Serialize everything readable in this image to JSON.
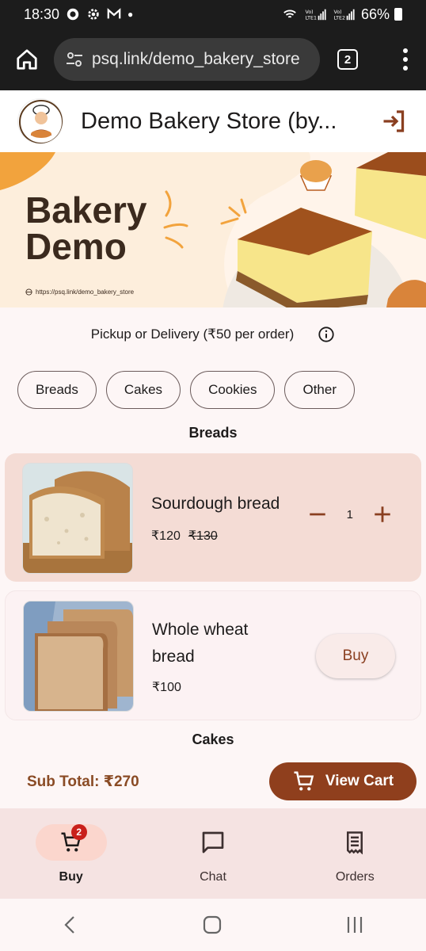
{
  "status_bar": {
    "time": "18:30",
    "battery": "66%"
  },
  "browser": {
    "url": "psq.link/demo_bakery_store",
    "tab_count": "2"
  },
  "header": {
    "title": "Demo Bakery Store (by..."
  },
  "banner": {
    "title_line1": "Bakery",
    "title_line2": "Demo",
    "url": "https://psq.link/demo_bakery_store"
  },
  "info": {
    "text": "Pickup or Delivery (₹50 per order)"
  },
  "categories": [
    "Breads",
    "Cakes",
    "Cookies",
    "Other"
  ],
  "sections": {
    "breads": "Breads",
    "cakes": "Cakes"
  },
  "products": [
    {
      "name": "Sourdough bread",
      "price": "₹120",
      "old_price": "₹130",
      "qty": "1"
    },
    {
      "name_line1": "Whole wheat",
      "name_line2": "bread",
      "price": "₹100",
      "action": "Buy"
    }
  ],
  "cart": {
    "subtotal": "Sub Total: ₹270",
    "view_cart": "View Cart"
  },
  "nav": {
    "buy": "Buy",
    "chat": "Chat",
    "orders": "Orders",
    "badge": "2"
  },
  "colors": {
    "accent": "#8f3f1d",
    "selected_card": "#f4dcd5",
    "nav_bg": "#f5e3e2",
    "badge": "#c9201b"
  }
}
